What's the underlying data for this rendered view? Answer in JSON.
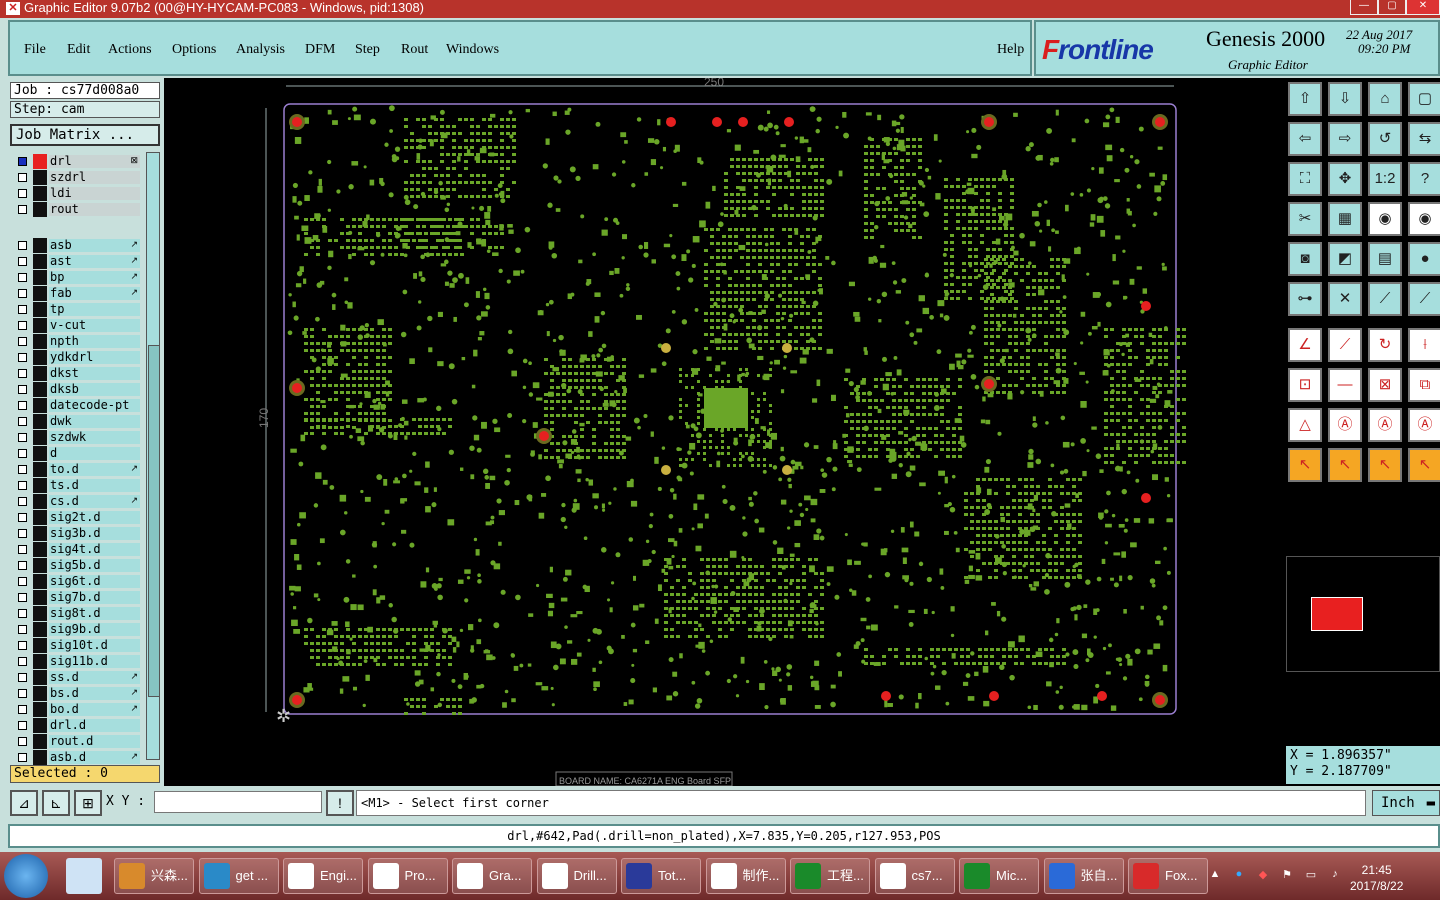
{
  "window": {
    "title": "Graphic Editor 9.07b2 (00@HY-HYCAM-PC083 - Windows, pid:1308)"
  },
  "menu": {
    "items": [
      "File",
      "Edit",
      "Actions",
      "Options",
      "Analysis",
      "DFM",
      "Step",
      "Rout",
      "Windows"
    ],
    "help": "Help"
  },
  "brand": {
    "logo_f": "F",
    "logo_rest": "rontline",
    "product": "Genesis 2000",
    "subtitle": "Graphic Editor",
    "date": "22 Aug 2017",
    "time": "09:20 PM"
  },
  "job": {
    "job": "Job : cs77d008a0",
    "step": "Step: cam",
    "matrix_button": "Job Matrix ..."
  },
  "layers": [
    {
      "name": "drl",
      "active": true,
      "highlight": true,
      "arrow": "⊠"
    },
    {
      "name": "szdrl",
      "highlight": true
    },
    {
      "name": "ldi",
      "highlight": true
    },
    {
      "name": "rout",
      "highlight": true
    },
    {
      "name": "asb",
      "arrow": "↗"
    },
    {
      "name": "ast",
      "arrow": "↗"
    },
    {
      "name": "bp",
      "arrow": "↗"
    },
    {
      "name": "fab",
      "arrow": "↗"
    },
    {
      "name": "tp"
    },
    {
      "name": "v-cut"
    },
    {
      "name": "npth"
    },
    {
      "name": "ydkdrl"
    },
    {
      "name": "dkst"
    },
    {
      "name": "dksb"
    },
    {
      "name": "datecode-pt"
    },
    {
      "name": "dwk"
    },
    {
      "name": "szdwk"
    },
    {
      "name": "d"
    },
    {
      "name": "to.d",
      "arrow": "↗"
    },
    {
      "name": "ts.d"
    },
    {
      "name": "cs.d",
      "arrow": "↗"
    },
    {
      "name": "sig2t.d"
    },
    {
      "name": "sig3b.d"
    },
    {
      "name": "sig4t.d"
    },
    {
      "name": "sig5b.d"
    },
    {
      "name": "sig6t.d"
    },
    {
      "name": "sig7b.d"
    },
    {
      "name": "sig8t.d"
    },
    {
      "name": "sig9b.d"
    },
    {
      "name": "sig10t.d"
    },
    {
      "name": "sig11b.d"
    },
    {
      "name": "ss.d",
      "arrow": "↗"
    },
    {
      "name": "bs.d",
      "arrow": "↗"
    },
    {
      "name": "bo.d",
      "arrow": "↗"
    },
    {
      "name": "drl.d"
    },
    {
      "name": "rout.d"
    },
    {
      "name": "asb.d",
      "arrow": "↗"
    }
  ],
  "selected": "Selected : 0",
  "canvas": {
    "dim_top": "250",
    "dim_left": "170",
    "board_name": "BOARD NAME: CA6271A ENG Board SFP"
  },
  "coords": {
    "x": "X = 1.896357\"",
    "y": "Y = 2.187709\""
  },
  "cmd": {
    "xy_label": "X Y :",
    "xy_value": "",
    "prompt": "<M1> - Select first corner",
    "unit": "Inch",
    "bang": "!"
  },
  "status": "drl,#642,Pad(.drill=non_plated),X=7.835,Y=0.205,r127.953,POS",
  "taskbar": {
    "items": [
      "兴森...",
      "get ...",
      "Engi...",
      "Pro...",
      "Gra...",
      "Drill...",
      "Tot...",
      "制作...",
      "工程...",
      "cs7...",
      "Mic...",
      "张自...",
      "Fox..."
    ],
    "time": "21:45",
    "date": "2017/8/22"
  },
  "colors": {
    "pcb_green": "#6aa628",
    "pad_red": "#e62020",
    "panel_teal": "#a6dedd",
    "title_red": "#b8332b"
  }
}
